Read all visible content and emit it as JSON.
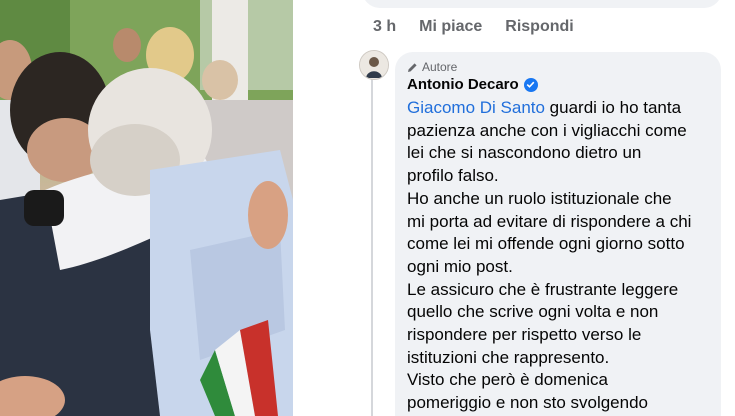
{
  "previous_comment": {
    "timestamp": "3 h",
    "like_label": "Mi piace",
    "reply_label": "Rispondi"
  },
  "comment": {
    "author_badge": "Autore",
    "author_name": "Antonio Decaro",
    "mention": "Giacomo Di Santo",
    "lines": [
      " guardi io ho tanta",
      "pazienza anche con i vigliacchi come",
      "lei che si nascondono dietro un",
      "profilo falso.",
      "Ho anche un ruolo istituzionale che",
      "mi porta ad evitare di rispondere a chi",
      "come lei mi offende ogni giorno sotto",
      "ogni mio post.",
      "Le assicuro che è frustrante leggere",
      "quello che scrive ogni volta e non",
      "rispondere per rispetto verso le",
      "istituzioni che rappresento.",
      "Visto che però è domenica",
      "pomeriggio e non sto svolgendo"
    ]
  },
  "colors": {
    "bubble": "#f0f2f5",
    "mention": "#216fdb",
    "verified": "#1877f2",
    "meta": "#65676b"
  }
}
